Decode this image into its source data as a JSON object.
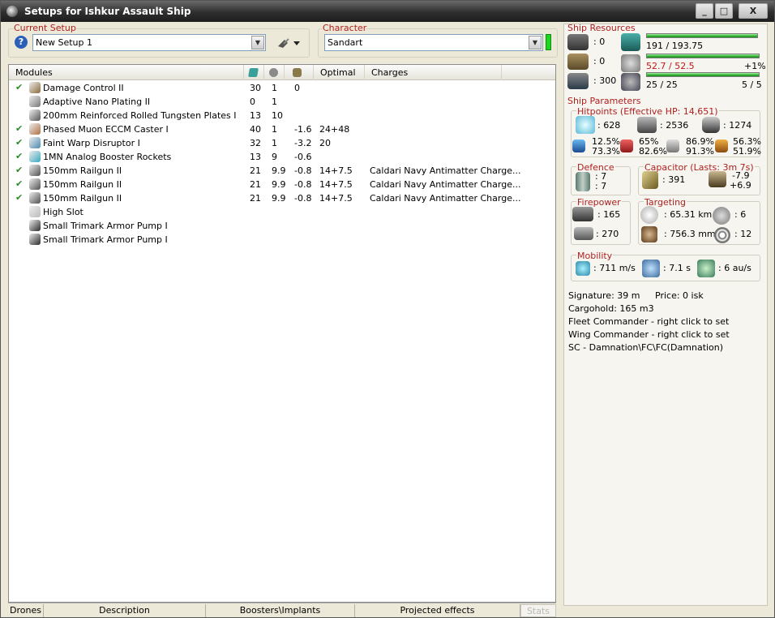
{
  "window": {
    "title": "Setups for Ishkur Assault Ship",
    "min": "_",
    "max": "□",
    "close": "X"
  },
  "setup": {
    "label": "Current Setup",
    "value": "New Setup 1"
  },
  "character": {
    "label": "Character",
    "value": "Sandart"
  },
  "modules": {
    "headers": [
      "Modules",
      "",
      "",
      "",
      "Optimal",
      "Charges"
    ],
    "header_icons": [
      "cpu-icon",
      "powergrid-icon",
      "capacitor-icon"
    ],
    "rows": [
      {
        "check": "✔",
        "name": "Damage Control II",
        "cpu": "30",
        "pg": "1",
        "cap": "0",
        "optimal": "",
        "charges": "",
        "icon": "damage-control-icon",
        "color": "#8a6a3a"
      },
      {
        "check": "",
        "name": "Adaptive Nano Plating II",
        "cpu": "0",
        "pg": "1",
        "cap": "",
        "optimal": "",
        "charges": "",
        "icon": "armor-plating-icon",
        "color": "#777777"
      },
      {
        "check": "",
        "name": "200mm Reinforced Rolled Tungsten Plates I",
        "cpu": "13",
        "pg": "10",
        "cap": "",
        "optimal": "",
        "charges": "",
        "icon": "armor-plate-icon",
        "color": "#555555"
      },
      {
        "check": "✔",
        "name": "Phased Muon ECCM Caster I",
        "cpu": "40",
        "pg": "1",
        "cap": "-1.6",
        "optimal": "24+48",
        "charges": "",
        "icon": "eccm-icon",
        "color": "#b07040"
      },
      {
        "check": "✔",
        "name": "Faint Warp Disruptor I",
        "cpu": "32",
        "pg": "1",
        "cap": "-3.2",
        "optimal": "20",
        "charges": "",
        "icon": "warp-disruptor-icon",
        "color": "#4a8ab0"
      },
      {
        "check": "✔",
        "name": "1MN Analog Booster Rockets",
        "cpu": "13",
        "pg": "9",
        "cap": "-0.6",
        "optimal": "",
        "charges": "",
        "icon": "afterburner-icon",
        "color": "#3aa8c0"
      },
      {
        "check": "✔",
        "name": "150mm Railgun II",
        "cpu": "21",
        "pg": "9.9",
        "cap": "-0.8",
        "optimal": "14+7.5",
        "charges": "Caldari Navy Antimatter Charge...",
        "icon": "railgun-icon",
        "color": "#505050"
      },
      {
        "check": "✔",
        "name": "150mm Railgun II",
        "cpu": "21",
        "pg": "9.9",
        "cap": "-0.8",
        "optimal": "14+7.5",
        "charges": "Caldari Navy Antimatter Charge...",
        "icon": "railgun-icon",
        "color": "#505050"
      },
      {
        "check": "✔",
        "name": "150mm Railgun II",
        "cpu": "21",
        "pg": "9.9",
        "cap": "-0.8",
        "optimal": "14+7.5",
        "charges": "Caldari Navy Antimatter Charge...",
        "icon": "railgun-icon",
        "color": "#505050"
      },
      {
        "check": "",
        "name": "High Slot",
        "cpu": "",
        "pg": "",
        "cap": "",
        "optimal": "",
        "charges": "",
        "icon": "high-slot-icon",
        "color": "#bbbbbb"
      },
      {
        "check": "",
        "name": "Small Trimark Armor Pump I",
        "cpu": "",
        "pg": "",
        "cap": "",
        "optimal": "",
        "charges": "",
        "icon": "rig-icon",
        "color": "#2a2a2a"
      },
      {
        "check": "",
        "name": "Small Trimark Armor Pump I",
        "cpu": "",
        "pg": "",
        "cap": "",
        "optimal": "",
        "charges": "",
        "icon": "rig-icon",
        "color": "#2a2a2a"
      }
    ]
  },
  "bottom_tabs": [
    "Drones",
    "Description",
    "Boosters\\Implants",
    "Projected effects",
    "Stats"
  ],
  "resources": {
    "label": "Ship Resources",
    "turret_slots": ": 0",
    "launcher_slots": ": 0",
    "calibration": ": 300",
    "cpu": "191 / 193.75",
    "cpu_fill": 0.986,
    "powergrid": "52.7 / 52.5",
    "powergrid_fill": 1.0,
    "powergrid_pct": "+1%",
    "drone_bay": "25 / 25",
    "drone_bay_fill": 1.0,
    "drones_active": "5 / 5"
  },
  "params": {
    "label": "Ship Parameters",
    "hitpoints_label": "Hitpoints (Effective HP: 14,651)",
    "shield_hp": ": 628",
    "armor_hp": ": 2536",
    "hull_hp": ": 1274",
    "em_a": "12.5%",
    "em_b": "73.3%",
    "th_a": "65%",
    "th_b": "82.6%",
    "kin_a": "86.9%",
    "kin_b": "91.3%",
    "exp_a": "56.3%",
    "exp_b": "51.9%",
    "defence_label": "Defence",
    "defence_1": ": 7",
    "defence_2": ": 7",
    "capacitor_label": "Capacitor (Lasts: 3m 7s)",
    "cap_amount": ": 391",
    "cap_delta_1": "-7.9",
    "cap_delta_2": "+6.9",
    "firepower_label": "Firepower",
    "volley": ": 165",
    "dps": ": 270",
    "targeting_label": "Targeting",
    "target_range": ": 65.31 km",
    "max_targets": ": 6",
    "scan_res": ": 756.3 mm",
    "sensor_strength": ": 12",
    "mobility_label": "Mobility",
    "max_velocity": ": 711 m/s",
    "align_time": ": 7.1 s",
    "warp_speed": ": 6 au/s"
  },
  "info": {
    "signature": "Signature: 39 m",
    "price": "Price: 0 isk",
    "cargohold": "Cargohold: 165 m3",
    "fleet_commander": "Fleet Commander - right click to set",
    "wing_commander": "Wing Commander - right click to set",
    "squad_commander": "SC - Damnation\\FC\\FC(Damnation)"
  },
  "colors": {
    "accent_red": "#b02020",
    "check_green": "#2a8a2a",
    "bar_green": "#2db32d"
  }
}
